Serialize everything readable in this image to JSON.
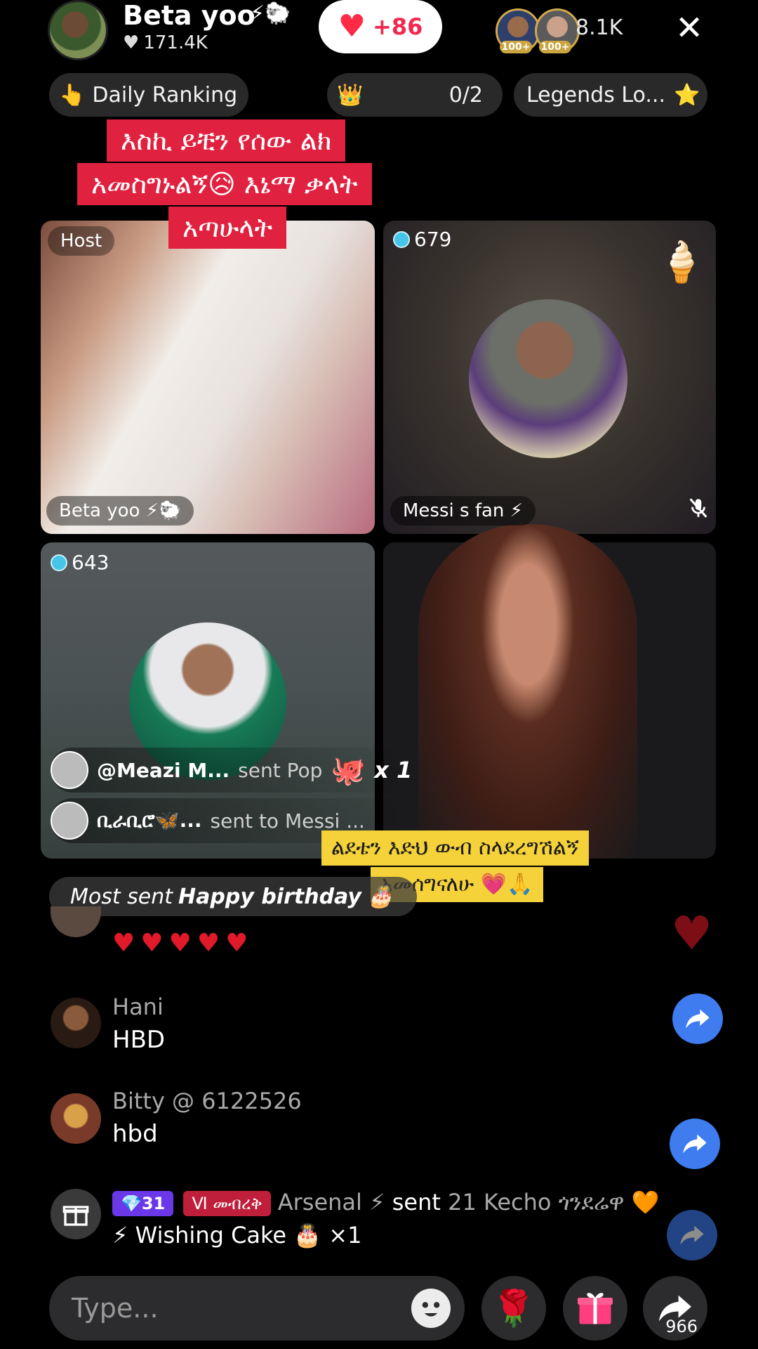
{
  "header": {
    "host_name": "Beta yoo",
    "host_badges": "⚡🐑",
    "host_likes": "171.4K",
    "like_increment": "+86",
    "viewer_tags": [
      "100+",
      "100+"
    ],
    "viewer_count": "8.1K"
  },
  "ranking": {
    "daily_label": "Daily Ranking",
    "daily_emoji": "👆",
    "progress": "0/2",
    "legends_label": "Legends Lo...",
    "legends_emoji": "⭐"
  },
  "banner": {
    "line1": "እስኪ ይቺን የሰው ልክ",
    "line2": "አመስግኑልኝ😥 እኔማ ቃላት",
    "line3": "አጣሁላት"
  },
  "grid": {
    "host_tag": "Host",
    "tile1_name": "Beta yoo ⚡🐑",
    "tile2_score": "679",
    "tile2_name": "Messi s fan ⚡",
    "tile3_score": "643"
  },
  "gifts": {
    "row1_user": "@Meazi M...",
    "row1_action": "sent Pop",
    "row1_count": "x 1",
    "row2_user": "ቢራቢሮ🦋...",
    "row2_action": "sent to Messi ..."
  },
  "overlay_caption": {
    "line1": "ልደቴን እድህ ውብ ስላደረግሽልኝ",
    "line2": "አመሰግናለሁ 💗🙏"
  },
  "most_sent": {
    "prefix": "Most sent",
    "gift": "Happy birthday",
    "emoji": "🎂"
  },
  "chat": {
    "hearts": "♥♥♥♥♥",
    "messages": [
      {
        "name": "Hani",
        "text": "HBD"
      },
      {
        "name": "Bitty @ 6122526",
        "text": "hbd"
      }
    ],
    "gift_log": {
      "level": "💎31",
      "vip_badge": "Ⅵ መብረቅ",
      "user": "Arsenal ⚡",
      "sent": "sent",
      "gift": "21 Kecho ጎንደሬዋ 🧡",
      "line2": "⚡ Wishing Cake 🎂 ×1"
    }
  },
  "input": {
    "placeholder": "Type...",
    "share_count": "966"
  },
  "colors": {
    "banner_red": "#e0213f",
    "caption_yellow": "#f5d23a",
    "share_blue": "#3f7cf0",
    "like_red": "#f2284f"
  }
}
